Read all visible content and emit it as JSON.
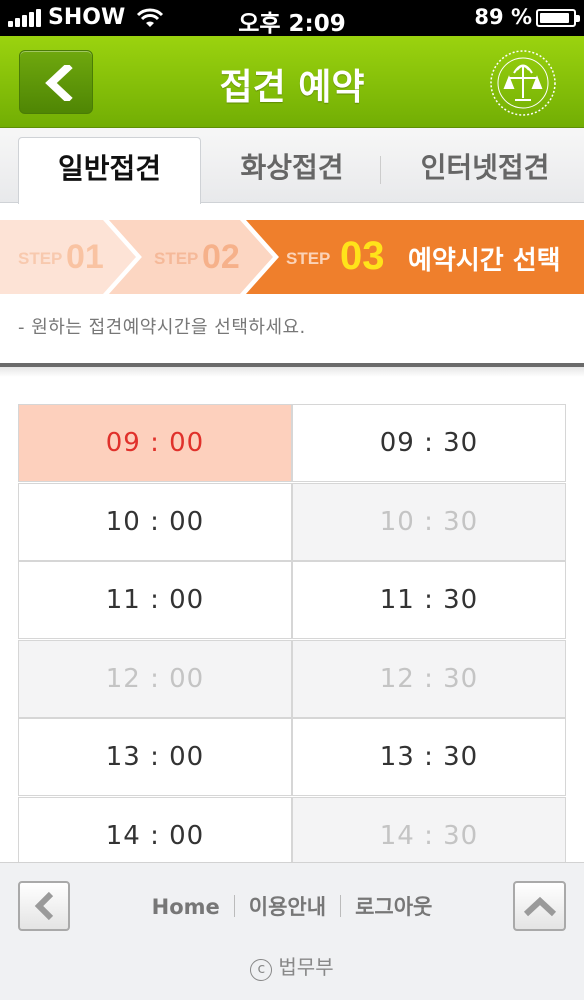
{
  "status_bar": {
    "carrier": "SHOW",
    "time": "오후 2:09",
    "battery": "89 %",
    "battery_level": 0.89
  },
  "header": {
    "title": "접견 예약",
    "back_icon": "chevron-left-icon",
    "emblem_icon": "ministry-of-justice-emblem"
  },
  "tabs": [
    {
      "label": "일반접견",
      "active": true
    },
    {
      "label": "화상접견",
      "active": false
    },
    {
      "label": "인터넷접견",
      "active": false
    }
  ],
  "steps": {
    "step_word": "STEP",
    "items": [
      {
        "num": "01"
      },
      {
        "num": "02"
      },
      {
        "num": "03",
        "title": "예약시간 선택",
        "active": true
      }
    ]
  },
  "instruction": "- 원하는 접견예약시간을 선택하세요.",
  "slots": [
    {
      "time": "09 : 00",
      "state": "selected"
    },
    {
      "time": "09 : 30",
      "state": "available"
    },
    {
      "time": "10 : 00",
      "state": "available"
    },
    {
      "time": "10 : 30",
      "state": "disabled"
    },
    {
      "time": "11 : 00",
      "state": "available"
    },
    {
      "time": "11 : 30",
      "state": "available"
    },
    {
      "time": "12 : 00",
      "state": "disabled"
    },
    {
      "time": "12 : 30",
      "state": "disabled"
    },
    {
      "time": "13 : 00",
      "state": "available"
    },
    {
      "time": "13 : 30",
      "state": "available"
    },
    {
      "time": "14 : 00",
      "state": "available"
    },
    {
      "time": "14 : 30",
      "state": "disabled"
    }
  ],
  "footer": {
    "links": [
      "Home",
      "이용안내",
      "로그아웃"
    ],
    "copyright_symbol": "c",
    "copyright": "법무부"
  },
  "colors": {
    "header_green": "#8cc40b",
    "step_active": "#ef7f2c",
    "step_inactive": "#fcd5c1",
    "selected_bg": "#fdd0bd",
    "selected_text": "#e0312b"
  }
}
